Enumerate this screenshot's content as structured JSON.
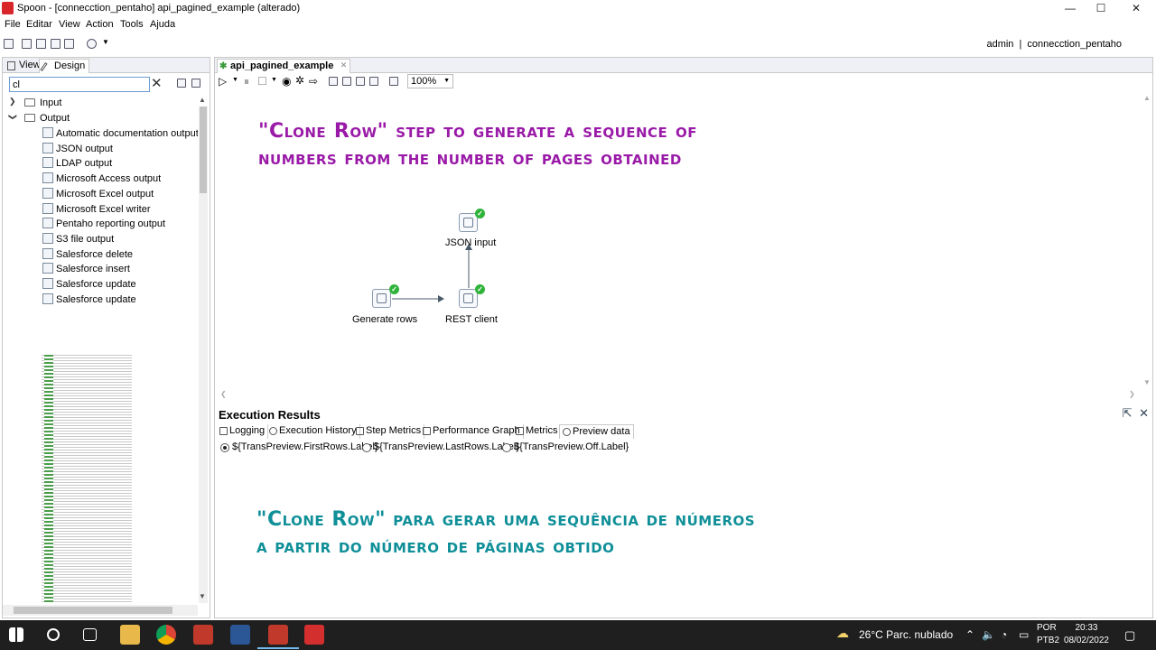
{
  "window": {
    "title": "Spoon - [connecction_pentaho] api_pagined_example (alterado)",
    "min": "—",
    "max": "☐",
    "close": "✕"
  },
  "menu": [
    "File",
    "Editar",
    "View",
    "Action",
    "Tools",
    "Ajuda"
  ],
  "user": {
    "name": "admin",
    "sep": "|",
    "repo": "connecction_pentaho"
  },
  "left_panel": {
    "tabs": [
      "View",
      "Design"
    ],
    "search_value": "cl",
    "clear": "✕",
    "tree": [
      {
        "type": "folder",
        "label": "Input",
        "expanded": false
      },
      {
        "type": "folder",
        "label": "Output",
        "expanded": true
      }
    ],
    "steps": [
      "Automatic documentation output",
      "JSON output",
      "LDAP output",
      "Microsoft Access output",
      "Microsoft Excel output",
      "Microsoft Excel writer",
      "Pentaho reporting output",
      "S3 file output",
      "Salesforce delete",
      "Salesforce insert",
      "Salesforce update",
      "Salesforce update"
    ]
  },
  "editor": {
    "tab_label": "api_pagined_example",
    "zoom": "100%",
    "overlay_en": "\"Clone Row\" step to generate a sequence of numbers from the number of pages obtained",
    "nodes": [
      {
        "label": "JSON input"
      },
      {
        "label": "Generate rows"
      },
      {
        "label": "REST client"
      }
    ]
  },
  "results": {
    "title": "Execution Results",
    "tabs": [
      "Logging",
      "Execution History",
      "Step Metrics",
      "Performance Graph",
      "Metrics",
      "Preview data"
    ],
    "radios": [
      "${TransPreview.FirstRows.Label}",
      "${TransPreview.LastRows.Label}",
      "${TransPreview.Off.Label}"
    ],
    "overlay_pt_line1": "\"Clone Row\" para gerar uma sequência de números",
    "overlay_pt_line2": "a partir do número de páginas obtido"
  },
  "taskbar": {
    "weather": "26°C  Parc. nublado",
    "lang1": "POR",
    "lang2": "PTB2",
    "time": "20:33",
    "date": "08/02/2022"
  },
  "colors": {
    "overlay_en": "#9a1aa8",
    "overlay_pt": "#0f8f98",
    "success": "#2fb33a"
  }
}
